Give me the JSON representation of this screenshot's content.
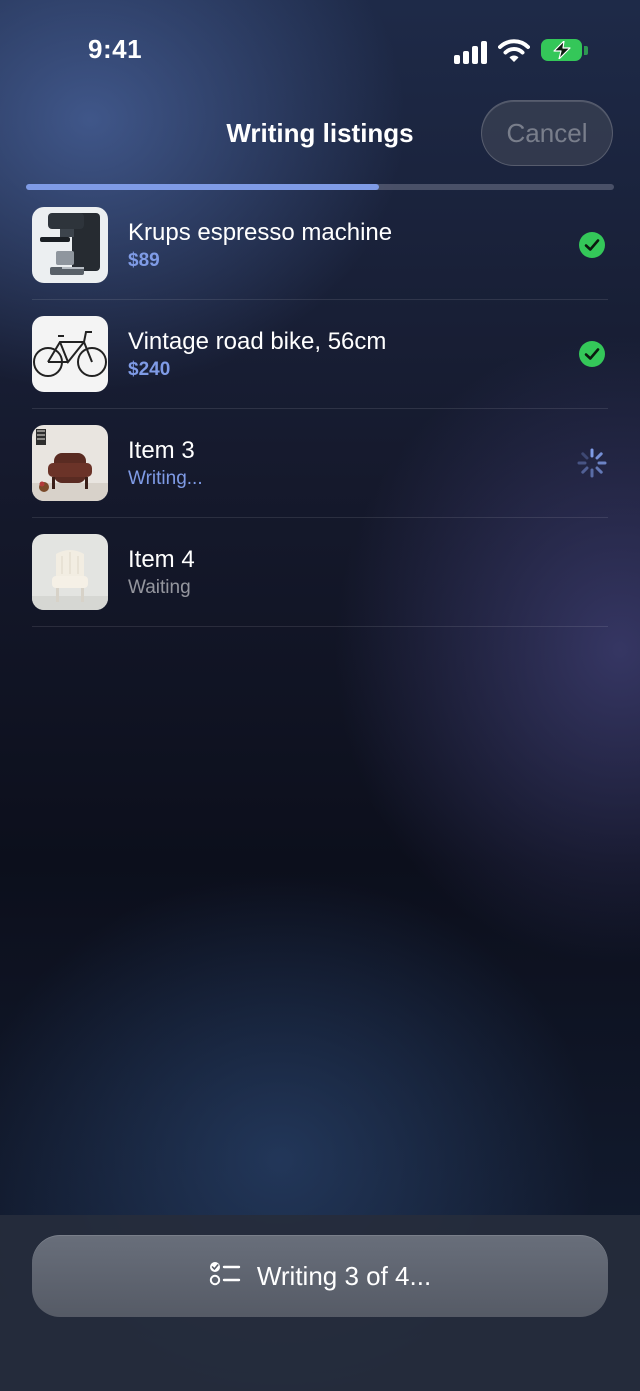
{
  "status_bar": {
    "time": "9:41",
    "signal_icon": "cellular-signal-icon",
    "wifi_icon": "wifi-icon",
    "battery_icon": "battery-charging-icon"
  },
  "nav": {
    "title": "Writing listings",
    "cancel_label": "Cancel",
    "progress_fraction": 0.6
  },
  "items": [
    {
      "title": "Krups espresso machine",
      "subtitle": "$89",
      "status": "done",
      "status_icon": "check-circle-icon",
      "thumb": "espresso-machine-photo"
    },
    {
      "title": "Vintage road bike, 56cm",
      "subtitle": "$240",
      "status": "done",
      "status_icon": "check-circle-icon",
      "thumb": "road-bike-photo"
    },
    {
      "title": "Item 3",
      "subtitle": "Writing...",
      "status": "writing",
      "status_icon": "spinner-icon",
      "thumb": "armchair-photo"
    },
    {
      "title": "Item 4",
      "subtitle": "Waiting",
      "status": "waiting",
      "status_icon": "",
      "thumb": "white-chair-photo"
    }
  ],
  "bottom": {
    "label": "Writing 3 of 4...",
    "icon": "checklist-icon"
  },
  "colors": {
    "accent": "#7f9be6",
    "success": "#34c759",
    "background": "#15192c"
  }
}
